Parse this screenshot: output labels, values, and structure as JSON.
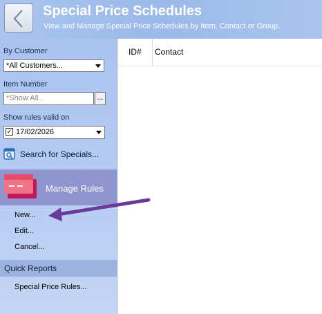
{
  "header": {
    "title": "Special Price Schedules",
    "subtitle": "View and Manage Special Price Schedules by Item, Contact or Group."
  },
  "filters": {
    "customer_label": "By Customer",
    "customer_value": "*All Customers...",
    "item_label": "Item Number",
    "item_placeholder": "*Show All...",
    "item_button": "...",
    "date_label": "Show rules valid on",
    "date_value": "17/02/2026",
    "date_checked": "✓"
  },
  "search": {
    "label": "Search for Specials..."
  },
  "manage": {
    "title": "Manage Rules",
    "items": [
      "New...",
      "Edit...",
      "Cancel..."
    ]
  },
  "reports": {
    "title": "Quick Reports",
    "items": [
      "Special Price Rules..."
    ]
  },
  "table": {
    "columns": [
      "ID#",
      "Contact"
    ]
  },
  "colors": {
    "header_bg": "#9bb9ea",
    "sidebar_bg": "#b7cdf3",
    "manage_panel_bg": "#8f95cf",
    "arrow_color": "#6a3a9a"
  }
}
